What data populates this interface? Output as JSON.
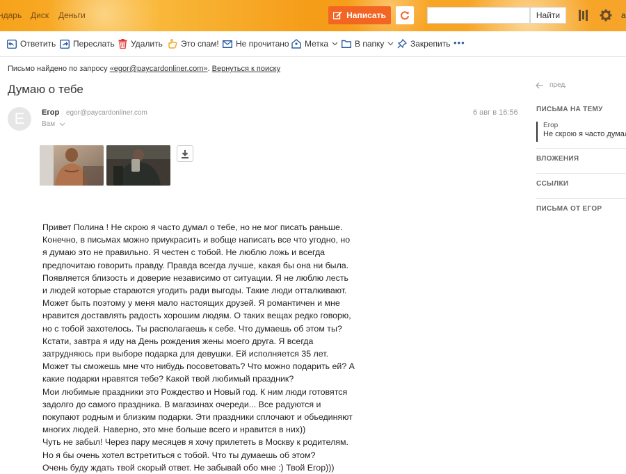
{
  "header": {
    "nav": [
      "ндарь",
      "Диск",
      "Деньги"
    ],
    "compose_label": "Написать",
    "search_placeholder": "",
    "search_button": "Найти",
    "user_initial": "а",
    "icons": [
      "pencil-icon",
      "refresh-icon",
      "apps-icon",
      "gear-icon"
    ]
  },
  "toolbar": {
    "reply": "Ответить",
    "forward": "Переслать",
    "delete": "Удалить",
    "spam": "Это спам!",
    "unread": "Не прочитано",
    "label": "Метка",
    "move": "В папку",
    "pin": "Закрепить",
    "more": "•••"
  },
  "search_info": {
    "prefix": "Письмо найдено по запросу ",
    "query": "«egor@paycardonliner.com»",
    "sep": ". ",
    "back": "Вернуться к поиску"
  },
  "message": {
    "subject": "Думаю о тебе",
    "avatar_letter": "E",
    "sender_name": "Егор",
    "sender_email": "egor@paycardonliner.com",
    "recipient": "Вам",
    "date": "6 авг в 16:56",
    "body_lines": [
      "Привет Полина ! Не скрою я часто думал о тебе, но не мог писать раньше.",
      "Конечно, в письмах можно приукрасить и вобще написать все что угодно, но",
      "я думаю это не правильно. Я честен с тобой. Не люблю ложь и всегда",
      "предпочитаю говорить правду. Правда всегда лучше, какая бы она ни была.",
      "Появляется близость и доверие независимо от ситуации. Я не люблю лесть",
      "и людей которые стараются угодить ради выгоды. Такие люди отталкивают.",
      "Может быть поэтому у меня мало настоящих друзей. Я романтичен и мне",
      "нравится доставлять радость хорошим людям. О таких вещах редко говорю,",
      "но с тобой захотелось. Ты располагаешь к себе. Что думаешь об этом ты?",
      "Кстати, завтра я иду на День рождения жены моего друга. Я всегда",
      "затрудняюсь при выборе подарка для девушки. Ей исполняется 35 лет.",
      "Может ты сможешь мне что нибудь посоветовать? Что можно подарить ей? А",
      "какие подарки нравятся тебе? Какой твой любимый праздник?",
      "Мои любимые праздники это Рождество и Новый год. К ним люди готовятся",
      "задолго до самого праздника. В магазинах очереди... Все радуются и",
      "покупают родным и близким подарки. Эти праздники сплочают и обьединяют",
      "многих людей. Наверно, это мне больше всего и нравится в них))",
      "Чуть не забыл! Через пару месяцев я хочу прилететь в Москву к родителям.",
      "Но я бы очень хотел встретиться с тобой. Что ты думаешь об этом?",
      "Очень буду ждать твой скорый ответ. Не забывай обо мне :) Твой Егор)))"
    ]
  },
  "sidebar": {
    "prev": "пред.",
    "thread_heading": "ПИСЬМА НА ТЕМУ",
    "thread_author": "Егор",
    "thread_snippet": "Не скрою я часто думал о тебе",
    "attachments_heading": "ВЛОЖЕНИЯ",
    "links_heading": "ССЫЛКИ",
    "from_heading": "ПИСЬМА ОТ ЕГОР"
  },
  "colors": {
    "accent": "#f26522",
    "header_bg": "#f7a21b",
    "link": "#333333"
  }
}
